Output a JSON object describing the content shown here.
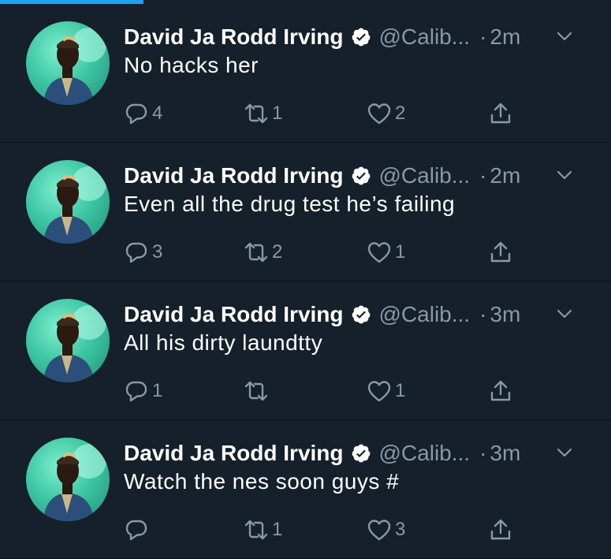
{
  "progress": {
    "fraction": 0.235,
    "color": "#1da1f2"
  },
  "colors": {
    "background": "#15202b",
    "secondary_text": "#8899a6",
    "verified": "#ffffff"
  },
  "tweets": [
    {
      "name": "David Ja Rodd Irving",
      "handle": "@Calib...",
      "dot": "·",
      "time": "2m",
      "text": "No hacks her",
      "reply_count": "4",
      "retweet_count": "1",
      "like_count": "2"
    },
    {
      "name": "David Ja Rodd Irving",
      "handle": "@Calib...",
      "dot": "·",
      "time": "2m",
      "text": "Even all the drug test he’s failing",
      "reply_count": "3",
      "retweet_count": "2",
      "like_count": "1"
    },
    {
      "name": "David Ja Rodd Irving",
      "handle": "@Calib...",
      "dot": "·",
      "time": "3m",
      "text": "All his dirty laundtty",
      "reply_count": "1",
      "retweet_count": "",
      "like_count": "1"
    },
    {
      "name": "David Ja Rodd Irving",
      "handle": "@Calib...",
      "dot": "·",
      "time": "3m",
      "text": "Watch the nes soon guys #",
      "reply_count": "",
      "retweet_count": "1",
      "like_count": "3"
    }
  ],
  "icons": {
    "verified": "verified-badge-icon",
    "caret": "chevron-down-icon",
    "reply": "reply-icon",
    "retweet": "retweet-icon",
    "like": "heart-icon",
    "share": "share-icon",
    "avatar": "profile-photo"
  }
}
